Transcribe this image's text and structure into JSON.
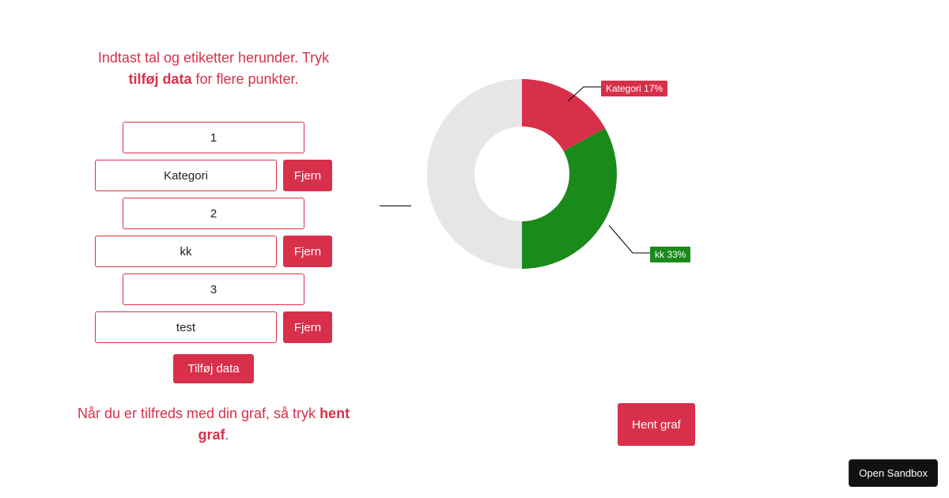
{
  "colors": {
    "accent": "#d8304a",
    "slice1": "#d8304a",
    "slice2": "#1a8a1a",
    "other": "#e6e6e6"
  },
  "instructions": {
    "top_pre": "Indtast tal og etiketter herunder. Tryk ",
    "top_bold": "tilføj data",
    "top_post": " for flere punkter.",
    "bottom_pre": "Når du er tilfreds med din graf, så tryk ",
    "bottom_bold": "hent graf",
    "bottom_post": "."
  },
  "buttons": {
    "remove": "Fjern",
    "add": "Tilføj data",
    "fetch": "Hent graf",
    "sandbox": "Open Sandbox"
  },
  "rows": [
    {
      "value": "1",
      "label": "Kategori"
    },
    {
      "value": "2",
      "label": "kk"
    },
    {
      "value": "3",
      "label": "test"
    }
  ],
  "chart_data": {
    "type": "pie",
    "donut": true,
    "slices": [
      {
        "name": "Kategori",
        "value": 1,
        "percent": 17,
        "color": "#d8304a",
        "label": "Kategori 17%"
      },
      {
        "name": "kk",
        "value": 2,
        "percent": 33,
        "color": "#1a8a1a",
        "label": "kk 33%"
      },
      {
        "name": "",
        "value": 3,
        "percent": 50,
        "color": "#e6e6e6",
        "label": ""
      }
    ]
  }
}
